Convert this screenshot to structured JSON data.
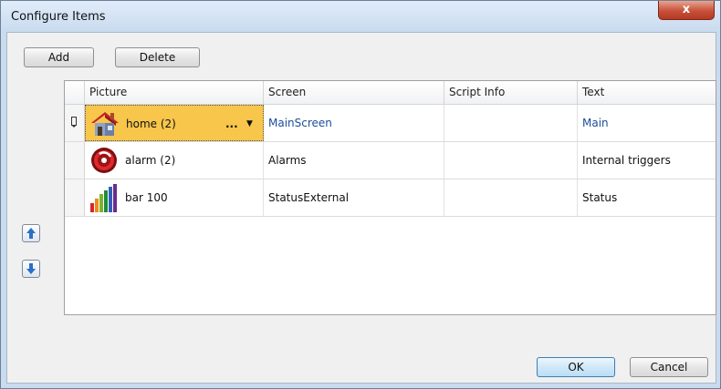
{
  "window": {
    "title": "Configure Items",
    "close_label": "x"
  },
  "toolbar": {
    "add_label": "Add",
    "delete_label": "Delete"
  },
  "grid": {
    "columns": [
      "Picture",
      "Screen",
      "Script Info",
      "Text"
    ],
    "rows": [
      {
        "picture": "home (2)",
        "icon": "house-icon",
        "screen": "MainScreen",
        "script_info": "",
        "text": "Main",
        "selected": true
      },
      {
        "picture": "alarm (2)",
        "icon": "alarm-icon",
        "screen": "Alarms",
        "script_info": "",
        "text": "Internal triggers",
        "selected": false
      },
      {
        "picture": "bar 100",
        "icon": "bar-chart-icon",
        "screen": "StatusExternal",
        "script_info": "",
        "text": "Status",
        "selected": false
      }
    ],
    "ellipsis": "...",
    "dropdown_glyph": "▼"
  },
  "footer": {
    "ok_label": "OK",
    "cancel_label": "Cancel"
  },
  "colors": {
    "selected_row": "#f7c64a",
    "link_text": "#1c4d9c",
    "title_bg": "#c9dbef"
  }
}
